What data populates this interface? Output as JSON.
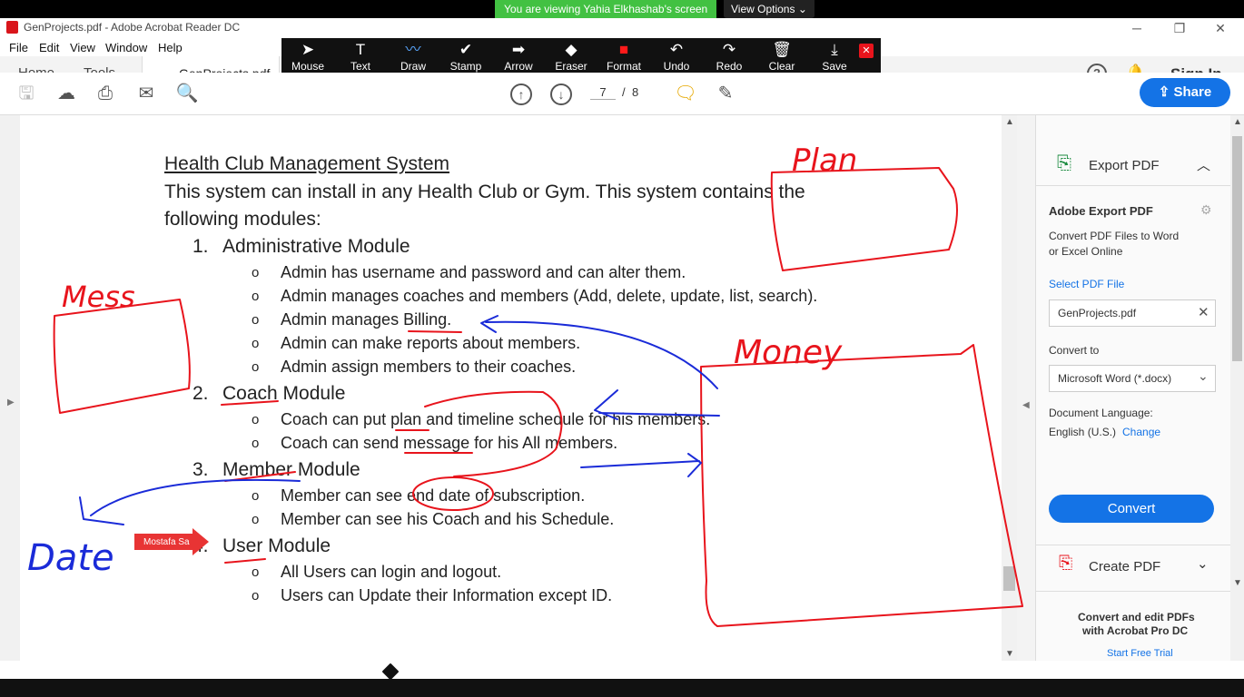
{
  "share_banner": {
    "text": "You are viewing Yahia Elkhashab's screen",
    "view_options": "View Options"
  },
  "window": {
    "title": "GenProjects.pdf - Adobe Acrobat Reader DC"
  },
  "menu": [
    "File",
    "Edit",
    "View",
    "Window",
    "Help"
  ],
  "tabs": {
    "home": "Home",
    "tools": "Tools",
    "document": "GenProjects.pdf"
  },
  "account": {
    "sign_in": "Sign In"
  },
  "annotation_tools": [
    {
      "label": "Mouse",
      "icon": "cursor-icon",
      "glyph": "➤"
    },
    {
      "label": "Text",
      "icon": "text-icon",
      "glyph": "T"
    },
    {
      "label": "Draw",
      "icon": "draw-icon",
      "glyph": "〰"
    },
    {
      "label": "Stamp",
      "icon": "stamp-icon",
      "glyph": "✔"
    },
    {
      "label": "Arrow",
      "icon": "arrow-icon",
      "glyph": "➡"
    },
    {
      "label": "Eraser",
      "icon": "eraser-icon",
      "glyph": "◆"
    },
    {
      "label": "Format",
      "icon": "format-icon",
      "glyph": "■"
    },
    {
      "label": "Undo",
      "icon": "undo-icon",
      "glyph": "↶"
    },
    {
      "label": "Redo",
      "icon": "redo-icon",
      "glyph": "↷"
    },
    {
      "label": "Clear",
      "icon": "trash-icon",
      "glyph": "🗑"
    },
    {
      "label": "Save",
      "icon": "save-icon",
      "glyph": "⤓"
    }
  ],
  "page_nav": {
    "current": "7",
    "separator": "/",
    "total": "8"
  },
  "share_button": "Share",
  "document": {
    "title": "Health Club Management System",
    "intro_line1": "This system can install in any Health Club or Gym. This system contains the",
    "intro_line2": "following modules:",
    "modules": [
      {
        "number": "1.",
        "name": "Administrative Module",
        "items": [
          "Admin has username and password and can alter them.",
          "Admin manages coaches and members (Add, delete, update, list, search).",
          "Admin manages Billing.",
          "Admin can make reports about members.",
          "Admin assign members to their coaches."
        ]
      },
      {
        "number": "2.",
        "name": "Coach Module",
        "items": [
          "Coach can put plan and timeline schedule for his members.",
          "Coach can send message for his All members."
        ]
      },
      {
        "number": "3.",
        "name": "Member Module",
        "items": [
          "Member can see end date of subscription.",
          "Member can see his Coach and his Schedule."
        ]
      },
      {
        "number": "4.",
        "name": "User Module",
        "items": [
          "All Users can login and logout.",
          "Users can Update their Information except ID."
        ]
      }
    ],
    "bullet": "o"
  },
  "annotations": {
    "mess": "Mess",
    "plan": "Plan",
    "money": "Money",
    "date": "Date",
    "sticky": "Mostafa Sa"
  },
  "right_panel": {
    "export_title": "Export PDF",
    "adobe_export": "Adobe Export PDF",
    "desc_line1": "Convert PDF Files to Word",
    "desc_line2": "or Excel Online",
    "select_file": "Select PDF File",
    "file_name": "GenProjects.pdf",
    "convert_to": "Convert to",
    "format": "Microsoft Word (*.docx)",
    "doc_lang": "Document Language:",
    "lang": "English (U.S.)",
    "change": "Change",
    "convert_btn": "Convert",
    "create_pdf": "Create PDF",
    "promo_line1": "Convert and edit PDFs",
    "promo_line2": "with Acrobat Pro DC",
    "trial": "Start Free Trial"
  },
  "colors": {
    "accent": "#1473e6",
    "ink_red": "#e8141c",
    "ink_blue": "#1a2bd8",
    "share_green": "#42c142"
  }
}
